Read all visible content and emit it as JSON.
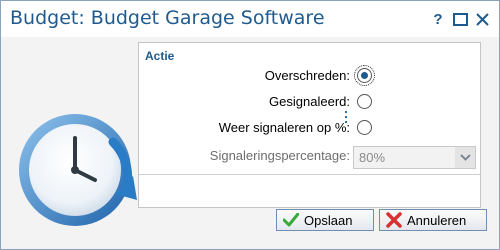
{
  "window": {
    "title": "Budget: Budget Garage Software",
    "controls": {
      "help_label": "?",
      "maximize_icon": "maximize-icon",
      "close_icon": "close-icon"
    }
  },
  "dialog_icon": "clock-icon",
  "section": {
    "title": "Actie",
    "fields": [
      {
        "label": "Overschreden:",
        "type": "radio",
        "checked": true,
        "focused": true
      },
      {
        "label": "Gesignaleerd:",
        "type": "radio",
        "checked": false
      },
      {
        "label": "Weer signaleren op %:",
        "type": "radio",
        "checked": false
      }
    ],
    "percentage": {
      "label": "Signaleringspercentage:",
      "value": "80%",
      "disabled": true
    }
  },
  "buttons": {
    "save": {
      "label": "Opslaan",
      "icon": "checkmark-icon"
    },
    "cancel": {
      "label": "Annuleren",
      "icon": "x-icon"
    }
  },
  "colors": {
    "accent": "#1f5a8e",
    "border": "#8aa3c2",
    "check": "#3aa83a",
    "cancel": "#d93030"
  }
}
